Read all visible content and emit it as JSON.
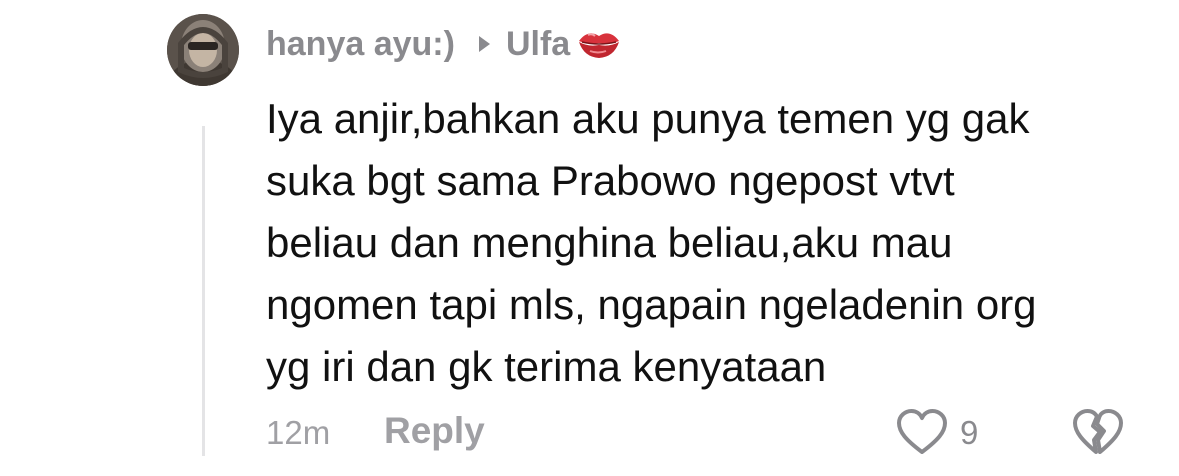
{
  "comment": {
    "author": "hanya ayu:)",
    "reply_to": "Ulfa",
    "reply_to_emoji_icon": "kiss-mark-icon",
    "lines": [
      "Iya anjir,bahkan aku punya temen yg gak",
      "suka bgt sama Prabowo ngepost vtvt",
      "beliau dan menghina beliau,aku mau",
      "ngomen tapi mls, ngapain ngeladenin org",
      "yg iri dan gk terima kenyataan"
    ],
    "timestamp": "12m",
    "reply_label": "Reply",
    "like_count": "9",
    "icons": {
      "like": "heart-outline-icon",
      "dislike": "broken-heart-outline-icon",
      "arrow": "play-arrow-icon"
    }
  },
  "colors": {
    "meta_gray": "#8a8a8e",
    "text": "#111111",
    "thread_line": "#e4e4e6",
    "kiss_red": "#d8323c"
  }
}
